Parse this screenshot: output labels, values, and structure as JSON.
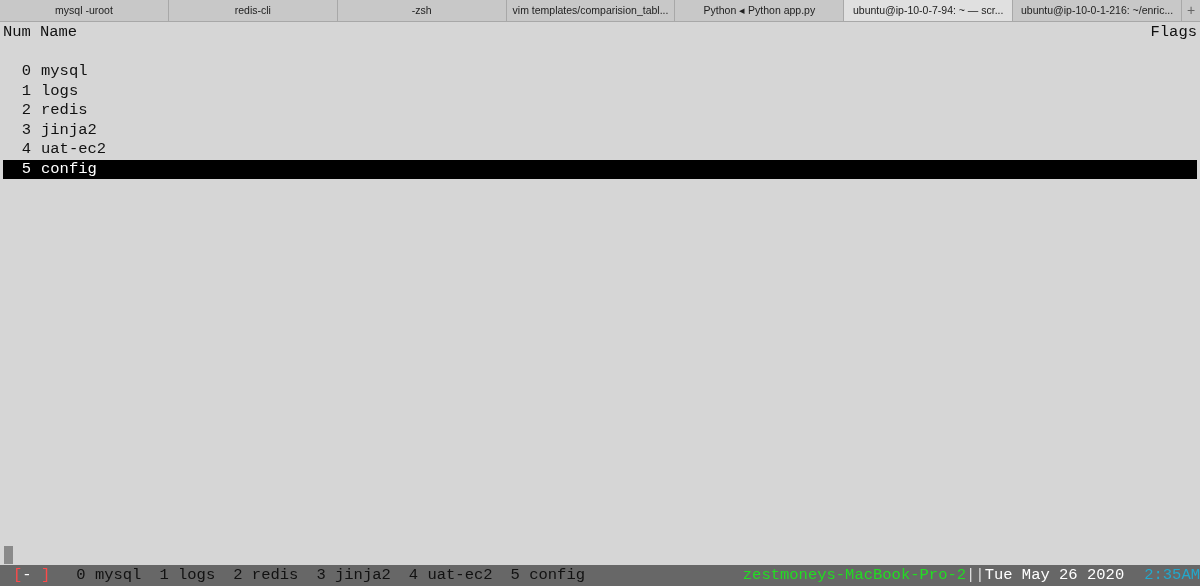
{
  "tabs": [
    {
      "label": "mysql -uroot",
      "selected": false
    },
    {
      "label": "redis-cli",
      "selected": false
    },
    {
      "label": "-zsh",
      "selected": false
    },
    {
      "label": "vim templates/comparision_tabl...",
      "selected": false
    },
    {
      "label": "Python ◂ Python app.py",
      "selected": false
    },
    {
      "label": "ubuntu@ip-10-0-7-94: ~ — scr...",
      "selected": true
    },
    {
      "label": "ubuntu@ip-10-0-1-216: ~/enric...",
      "selected": false
    }
  ],
  "new_tab": "+",
  "list": {
    "columns": [
      "Num",
      "Name",
      "Flags"
    ],
    "rows": [
      {
        "num": "0",
        "name": "mysql",
        "selected": false
      },
      {
        "num": "1",
        "name": "logs",
        "selected": false
      },
      {
        "num": "2",
        "name": "redis",
        "selected": false
      },
      {
        "num": "3",
        "name": "jinja2",
        "selected": false
      },
      {
        "num": "4",
        "name": "uat-ec2",
        "selected": false
      },
      {
        "num": "5",
        "name": "config",
        "selected": true
      }
    ]
  },
  "status_bar": {
    "open": "[",
    "mode": "-",
    "close": "]",
    "windows": [
      {
        "num": "0",
        "name": "mysql"
      },
      {
        "num": "1",
        "name": "logs"
      },
      {
        "num": "2",
        "name": "redis"
      },
      {
        "num": "3",
        "name": "jinja2"
      },
      {
        "num": "4",
        "name": "uat-ec2"
      },
      {
        "num": "5",
        "name": "config"
      }
    ],
    "host": "zestmoneys-MacBook-Pro-2",
    "separator": "||",
    "date": "Tue May 26 2020",
    "time": "2:35AM"
  }
}
